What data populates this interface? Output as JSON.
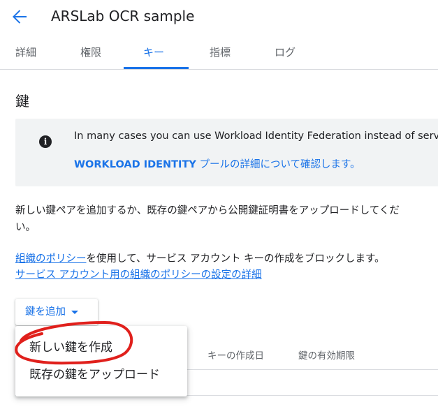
{
  "header": {
    "title": "ARSLab OCR sample",
    "back_icon": "arrow-back-icon"
  },
  "tabs": [
    {
      "label": "詳細",
      "active": false
    },
    {
      "label": "権限",
      "active": false
    },
    {
      "label": "キー",
      "active": true
    },
    {
      "label": "指標",
      "active": false
    },
    {
      "label": "ログ",
      "active": false
    }
  ],
  "section": {
    "title": "鍵"
  },
  "info": {
    "icon": "info-icon",
    "text": "In many cases you can use Workload Identity Federation instead of servi",
    "link_prefix": "WORKLOAD IDENTITY",
    "link_suffix": " プールの詳細について確認します。"
  },
  "description": {
    "line1": "新しい鍵ペアを追加するか、既存の鍵ペアから公開鍵証明書をアップロードしてくだ",
    "line2": "い。"
  },
  "policy": {
    "link1": "組織のポリシー",
    "text1": "を使用して、サービス アカウント キーの作成をブロックします。",
    "link2": "サービス アカウント用の組織のポリシーの設定の詳細"
  },
  "add_key": {
    "label": "鍵を追加"
  },
  "table": {
    "columns": [
      "キーの作成日",
      "鍵の有効期限"
    ]
  },
  "menu": {
    "items": [
      "新しい鍵を作成",
      "既存の鍵をアップロード"
    ]
  },
  "colors": {
    "accent": "#1a73e8",
    "annotation": "#e0201c"
  }
}
